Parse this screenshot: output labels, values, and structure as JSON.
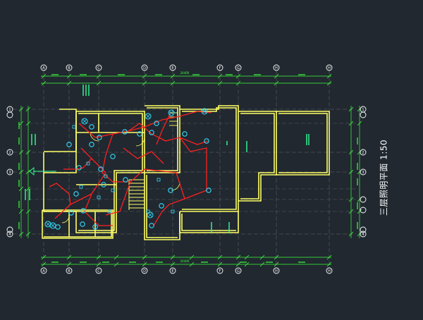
{
  "drawing": {
    "title": "三层照明平面 1:50",
    "background": "#212830",
    "colors": {
      "dimension": "#3cff3c",
      "wall": "#ffff66",
      "grid_bubble": "#ffffff",
      "axis": "#6b6b6b",
      "wiring": "#ff2020",
      "fixture": "#33ddff",
      "text_note": "#33ff99"
    },
    "grid_top": [
      "A",
      "B",
      "C",
      "D",
      "E",
      "F",
      "G",
      "H"
    ],
    "grid_left": [
      "1",
      "2",
      "3",
      "4"
    ],
    "grid_right": [
      "1",
      "2",
      "3",
      "4"
    ],
    "overall_dimension": "24400"
  }
}
